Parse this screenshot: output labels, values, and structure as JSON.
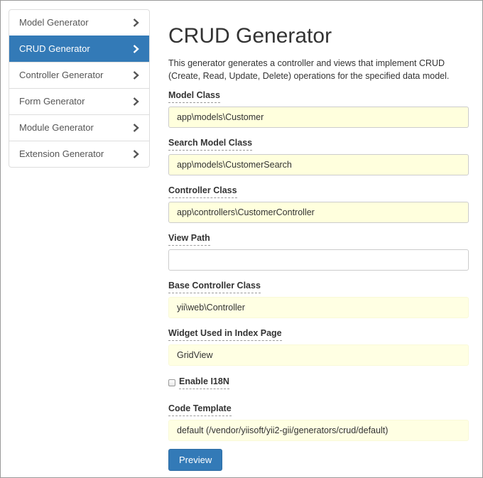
{
  "sidebar": {
    "items": [
      {
        "label": "Model Generator",
        "active": false
      },
      {
        "label": "CRUD Generator",
        "active": true
      },
      {
        "label": "Controller Generator",
        "active": false
      },
      {
        "label": "Form Generator",
        "active": false
      },
      {
        "label": "Module Generator",
        "active": false
      },
      {
        "label": "Extension Generator",
        "active": false
      }
    ]
  },
  "main": {
    "title": "CRUD Generator",
    "description": "This generator generates a controller and views that implement CRUD (Create, Read, Update, Delete) operations for the specified data model.",
    "fields": {
      "model_class": {
        "label": "Model Class",
        "value": "app\\models\\Customer"
      },
      "search_model_class": {
        "label": "Search Model Class",
        "value": "app\\models\\CustomerSearch"
      },
      "controller_class": {
        "label": "Controller Class",
        "value": "app\\controllers\\CustomerController"
      },
      "view_path": {
        "label": "View Path",
        "value": ""
      },
      "base_controller_class": {
        "label": "Base Controller Class",
        "value": "yii\\web\\Controller"
      },
      "widget_index_page": {
        "label": "Widget Used in Index Page",
        "value": "GridView"
      },
      "enable_i18n": {
        "label": "Enable I18N",
        "checked": false
      },
      "code_template": {
        "label": "Code Template",
        "value": "default (/vendor/yiisoft/yii2-gii/generators/crud/default)"
      }
    },
    "preview_label": "Preview"
  },
  "colors": {
    "accent": "#337ab7",
    "highlight_input": "#ffffdd",
    "frame_border": "#9a9a9a"
  },
  "icons": {
    "sidebar_chevron": "chevron-right-icon"
  }
}
